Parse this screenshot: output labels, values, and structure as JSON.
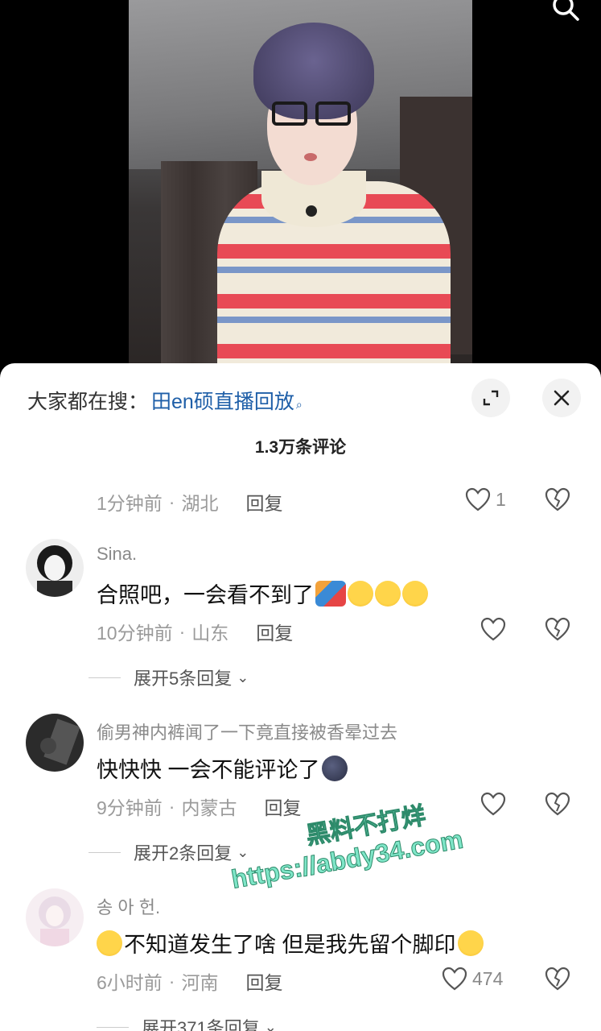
{
  "search_bar": {
    "prefix": "大家都在搜：",
    "term": "田en硕直播回放",
    "term_icon": "search-icon"
  },
  "comments_header": {
    "count_label": "1.3万条评论"
  },
  "top_partial_comment": {
    "time": "1分钟前",
    "location": "湖北",
    "reply_label": "回复",
    "like_count": "1"
  },
  "comments": [
    {
      "username": "Sina.",
      "content": "合照吧，一会看不到了",
      "emojis": [
        "running-emoji",
        "yum-emoji",
        "yum-emoji",
        "yum-emoji"
      ],
      "time": "10分钟前",
      "location": "山东",
      "reply_label": "回复",
      "like_count": "",
      "expand_label": "展开5条回复"
    },
    {
      "username": "偷男神内裤闻了一下竟直接被香晕过去",
      "content": "快快快 一会不能评论了",
      "emojis": [
        "moon-face-emoji"
      ],
      "time": "9分钟前",
      "location": "内蒙古",
      "reply_label": "回复",
      "like_count": "",
      "expand_label": "展开2条回复"
    },
    {
      "username": "송 아 헌.",
      "content": "不知道发生了啥 但是我先留个脚印",
      "emojis": [
        "grin-emoji",
        "yum-emoji"
      ],
      "time": "6小时前",
      "location": "河南",
      "reply_label": "回复",
      "like_count": "474",
      "expand_label": "展开371条回复"
    }
  ],
  "watermark": {
    "line1": "黑料不打烊",
    "line2": "https://abdy34.com"
  },
  "colors": {
    "search_term": "#1f5fa8",
    "sheet_bg": "#ffffff",
    "watermark": "#7fe6c8"
  }
}
